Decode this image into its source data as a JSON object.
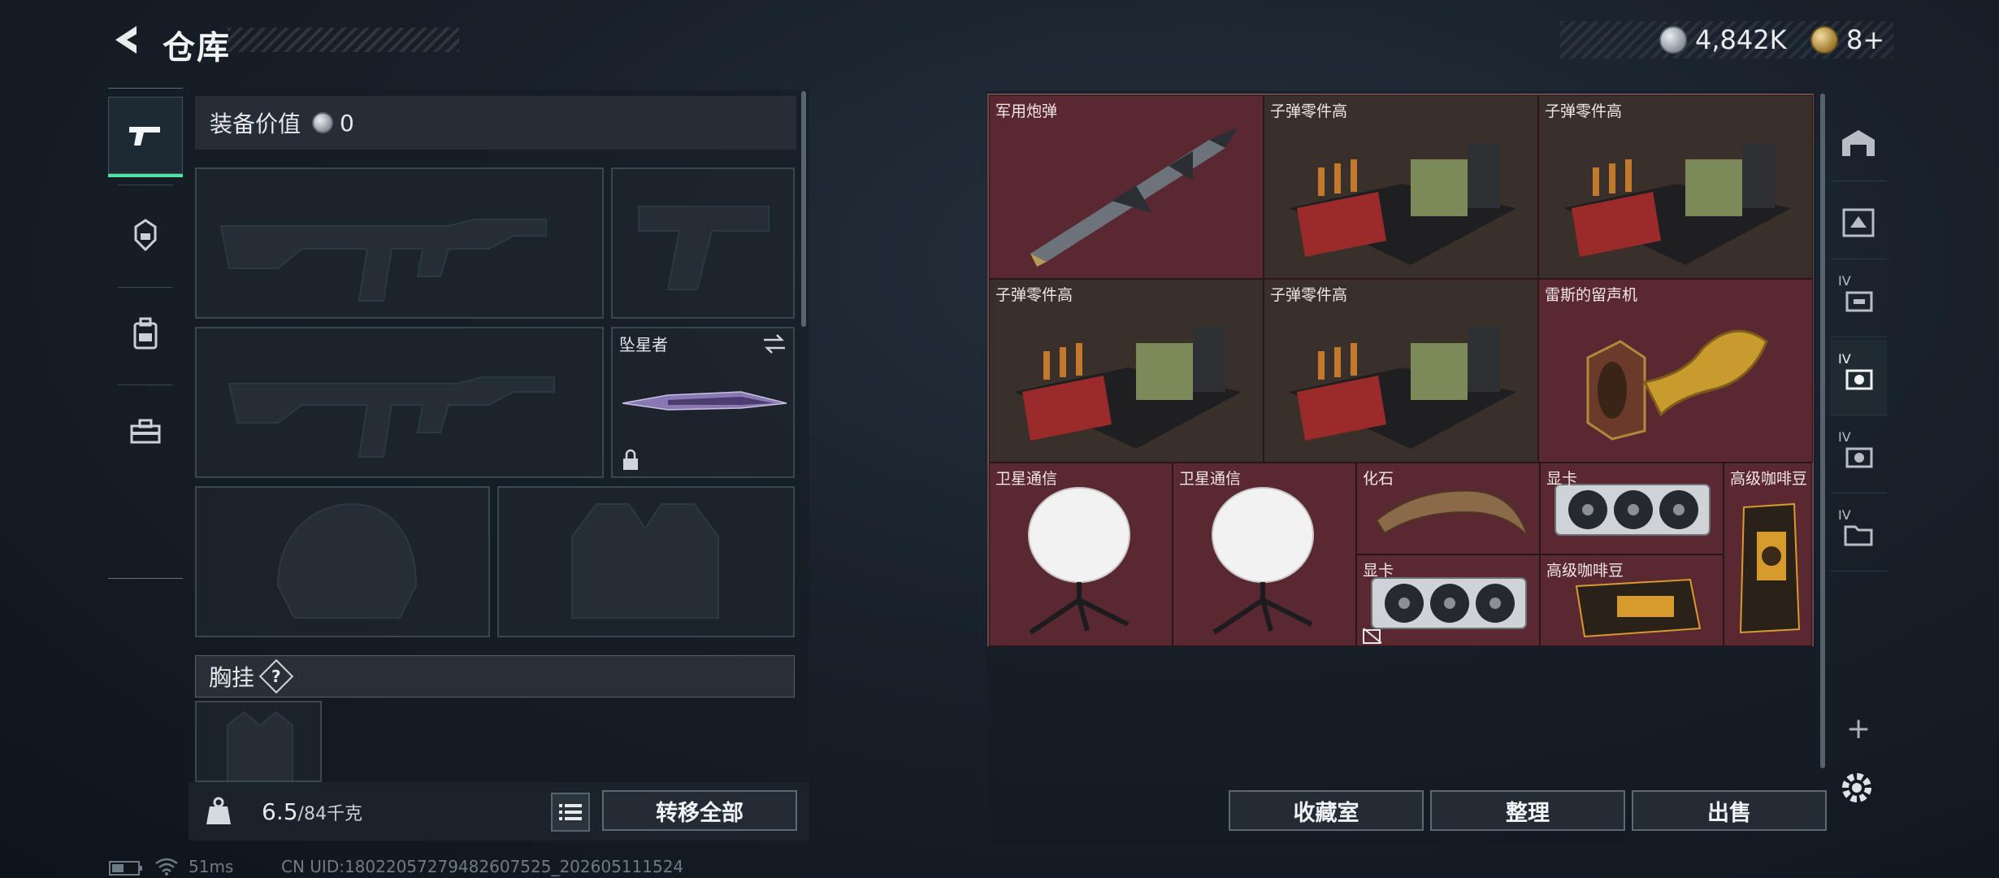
{
  "header": {
    "title": "仓库",
    "currency_silver": "4,842K",
    "currency_gold": "8+"
  },
  "loadout": {
    "value_label": "装备价值",
    "value": "0",
    "melee_name": "坠星者",
    "chest_rig_label": "胸挂",
    "help_symbol": "?",
    "weight_current": "6.5",
    "weight_max": "/84千克",
    "transfer_all": "转移全部"
  },
  "storage": {
    "items": [
      {
        "label": "军用炮弹"
      },
      {
        "label": "子弹零件高"
      },
      {
        "label": "子弹零件高"
      },
      {
        "label": "子弹零件高"
      },
      {
        "label": "子弹零件高"
      },
      {
        "label": "雷斯的留声机"
      },
      {
        "label": "卫星通信"
      },
      {
        "label": "卫星通信"
      },
      {
        "label": "化石"
      },
      {
        "label": "显卡"
      },
      {
        "label": "高级咖啡豆"
      },
      {
        "label": "显卡"
      },
      {
        "label": "高级咖啡豆"
      }
    ],
    "right_rail": [
      {
        "badge": ""
      },
      {
        "badge": ""
      },
      {
        "badge": "IV"
      },
      {
        "badge": "IV"
      },
      {
        "badge": "IV"
      },
      {
        "badge": "IV"
      }
    ],
    "add_symbol": "+"
  },
  "actions": {
    "collection": "收藏室",
    "organize": "整理",
    "sell": "出售"
  },
  "status": {
    "ping": "51ms",
    "uid": "CN UID:180220572794826075​25_202605111524"
  },
  "colors": {
    "accent_green": "#4fe2a2",
    "cell_red": "#5a2831",
    "cell_brown": "#39302a"
  }
}
